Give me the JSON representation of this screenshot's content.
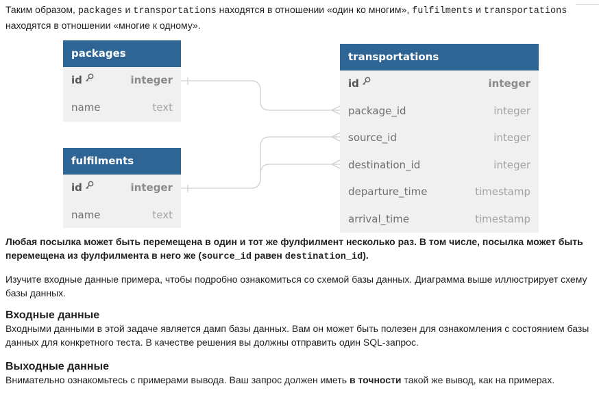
{
  "intro": {
    "t1": "Таким образом, ",
    "c1": "packages",
    "t2": " и ",
    "c2": "transportations",
    "t3": " находятся в отношении «один ко многим», ",
    "c3": "fulfilments",
    "t4": " и ",
    "c4": "transportations",
    "t5": " находятся в отношении «многие к одному»."
  },
  "diagram": {
    "tables": [
      {
        "name": "packages",
        "columns": [
          {
            "name": "id",
            "type": "integer",
            "pk": true
          },
          {
            "name": "name",
            "type": "text"
          }
        ]
      },
      {
        "name": "fulfilments",
        "columns": [
          {
            "name": "id",
            "type": "integer",
            "pk": true
          },
          {
            "name": "name",
            "type": "text"
          }
        ]
      },
      {
        "name": "transportations",
        "columns": [
          {
            "name": "id",
            "type": "integer",
            "pk": true
          },
          {
            "name": "package_id",
            "type": "integer"
          },
          {
            "name": "source_id",
            "type": "integer"
          },
          {
            "name": "destination_id",
            "type": "integer"
          },
          {
            "name": "departure_time",
            "type": "timestamp"
          },
          {
            "name": "arrival_time",
            "type": "timestamp"
          }
        ]
      }
    ],
    "colors": {
      "header": "#2f6594",
      "body": "#f0f0f0",
      "connector": "#cfcfcf"
    }
  },
  "note": {
    "t1": "Любая посылка может быть перемещена в один и тот же фулфилмент несколько раз. В том числе, посылка может быть перемещена из фулфилмента в него же (",
    "c1": "source_id",
    "t2": " равен ",
    "c2": "destination_id",
    "t3": ")."
  },
  "para1": "Изучите входные данные примера, чтобы подробно ознакомиться со схемой базы данных. Диаграмма выше иллюстрирует схему базы данных.",
  "input_section": {
    "heading": "Входные данные",
    "text": "Входными данными в этой задаче является дамп базы данных. Вам он может быть полезен для ознакомления с состоянием базы данных для конкретного теста. В качестве решения вы должны отправить один SQL-запрос."
  },
  "output_section": {
    "heading": "Выходные данные",
    "t1": "Внимательно ознакомьтесь с примерами вывода. Ваш запрос должен иметь ",
    "bold": "в точности",
    "t2": " такой же вывод, как на примерах."
  }
}
